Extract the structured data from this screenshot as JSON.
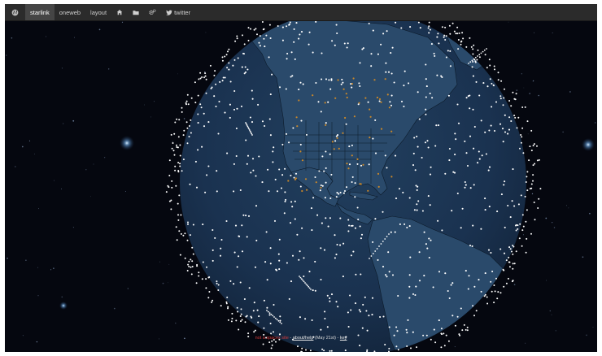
{
  "nav": {
    "globe_icon": "globe-icon",
    "items": [
      {
        "label": "starlink",
        "active": true
      },
      {
        "label": "oneweb",
        "active": false
      },
      {
        "label": "layout",
        "active": false
      }
    ],
    "home_icon": "home-icon",
    "folder_icon": "folder-icon",
    "settings_icon": "gears-icon",
    "twitter": {
      "icon": "twitter-icon",
      "label": "twitter"
    }
  },
  "footer": {
    "notice": "not a spacex site",
    "separator_1": " - ",
    "about_link": "about/help",
    "date_text": " (May 21st) - ",
    "key_link": "key"
  },
  "colors": {
    "navbar": "#2b2b2b",
    "navbar_active": "#454545",
    "space": "#05070f",
    "ocean": "#1c3550",
    "land": "#2a4a6b",
    "borders": "#0c1a29",
    "satellite": "#ffffff",
    "city": "#c8872a",
    "notice": "#d23a3a"
  }
}
